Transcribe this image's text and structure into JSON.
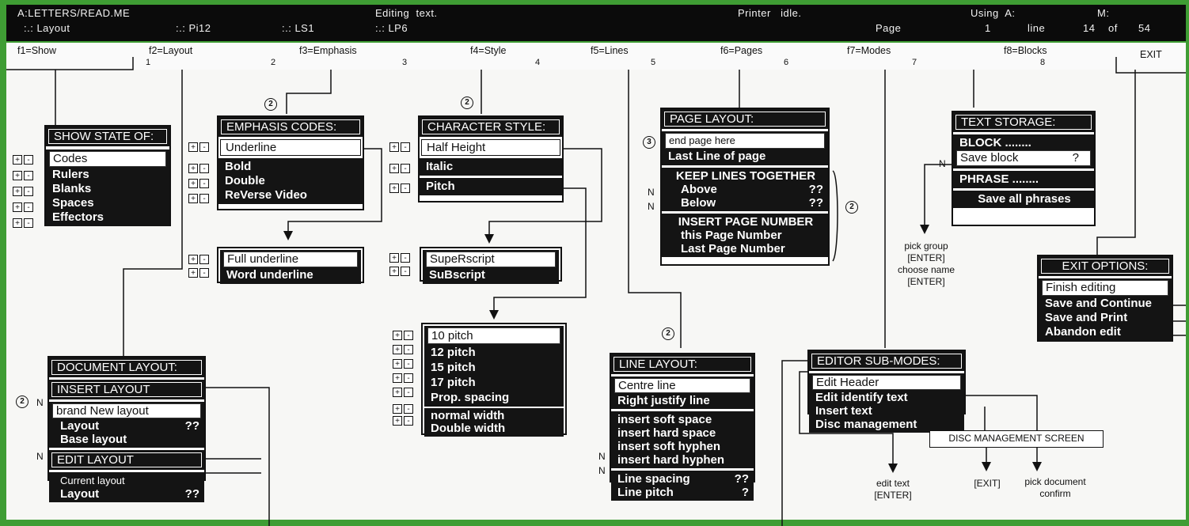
{
  "status": {
    "file": "A:LETTERS/READ.ME",
    "mode": "Editing  text.",
    "printer": "Printer   idle.",
    "using": "Using  A:",
    "m": "M:",
    "layout": ":.: Layout",
    "pi": ":.: Pi12",
    "ls": ":.: LS1",
    "lp": ":.: LP6",
    "page_label": "Page",
    "page": "1",
    "line_label": "line",
    "line": "14",
    "of_label": "of",
    "total": "54"
  },
  "fkeys": {
    "f1": "f1=Show",
    "f2": "f2=Layout",
    "f3": "f3=Emphasis",
    "f4": "f4=Style",
    "f5": "f5=Lines",
    "f6": "f6=Pages",
    "f7": "f7=Modes",
    "f8": "f8=Blocks",
    "exit": "EXIT",
    "ruler": [
      "1",
      "2",
      "3",
      "4",
      "5",
      "6",
      "7",
      "8"
    ]
  },
  "show": {
    "title": "SHOW STATE OF:",
    "items": [
      "Codes",
      "Rulers",
      "Blanks",
      "Spaces",
      "Effectors"
    ]
  },
  "emphasis": {
    "title": "EMPHASIS CODES:",
    "underline": "Underline",
    "items": [
      "Bold",
      "Double",
      "ReVerse Video"
    ],
    "sub": [
      "Full underline",
      "Word  underline"
    ]
  },
  "style": {
    "title": "CHARACTER STYLE:",
    "items": [
      "Half Height",
      "Italic",
      "Pitch"
    ],
    "script": [
      "SupeRscript",
      "SuBscript"
    ],
    "pitch": [
      "10 pitch",
      "12  pitch",
      "15  pitch",
      "17  pitch",
      "Prop. spacing"
    ],
    "width": [
      "normal  width",
      "Double  width"
    ]
  },
  "page": {
    "title": "PAGE LAYOUT:",
    "items": [
      "end page here",
      "Last Line of page"
    ],
    "keep_title": "KEEP LINES TOGETHER",
    "keep": [
      {
        "label": "Above",
        "val": "??"
      },
      {
        "label": "Below",
        "val": "??"
      }
    ],
    "insert_title": "INSERT PAGE NUMBER",
    "insert": [
      "this Page Number",
      "Last Page Number"
    ]
  },
  "line": {
    "title": "LINE LAYOUT:",
    "g1": [
      "Centre line",
      "Right  justify  line"
    ],
    "g2": [
      "insert soft space",
      "insert hard space",
      "insert soft hyphen",
      "insert hard hyphen"
    ],
    "g3": [
      {
        "label": "Line spacing",
        "val": "??"
      },
      {
        "label": "Line pitch",
        "val": "?"
      }
    ]
  },
  "storage": {
    "title": "TEXT STORAGE:",
    "block": "BLOCK  ........",
    "save_block": "Save block",
    "save_q": "?",
    "phrase": "PHRASE  ........",
    "save_all": "Save all phrases"
  },
  "doc": {
    "title": "DOCUMENT LAYOUT:",
    "insert_title": "INSERT LAYOUT",
    "insert": [
      {
        "label": "brand New layout",
        "val": ""
      },
      {
        "label": "Layout",
        "val": "??"
      },
      {
        "label": "Base layout",
        "val": ""
      }
    ],
    "edit_title": "EDIT LAYOUT",
    "edit": [
      {
        "label": "Current  layout",
        "val": ""
      },
      {
        "label": "Layout",
        "val": "??"
      }
    ]
  },
  "modes": {
    "title": "EDITOR SUB-MODES:",
    "items": [
      "Edit Header",
      "Edit  identify  text",
      "Insert  text",
      "Disc management"
    ]
  },
  "exitopts": {
    "title": "EXIT OPTIONS:",
    "items": [
      "Finish editing",
      "Save and Continue",
      "Save and Print",
      "Abandon edit"
    ]
  },
  "notes": {
    "pick_group": "pick group",
    "enter1": "[ENTER]",
    "choose_name": "choose name",
    "enter2": "[ENTER]",
    "disc_screen": "DISC MANAGEMENT SCREEN",
    "edit_text": "edit text",
    "enter3": "[ENTER]",
    "exit": "[EXIT]",
    "pick_doc": "pick document",
    "confirm": "confirm",
    "n": "N",
    "c2": "2",
    "c3": "3"
  }
}
